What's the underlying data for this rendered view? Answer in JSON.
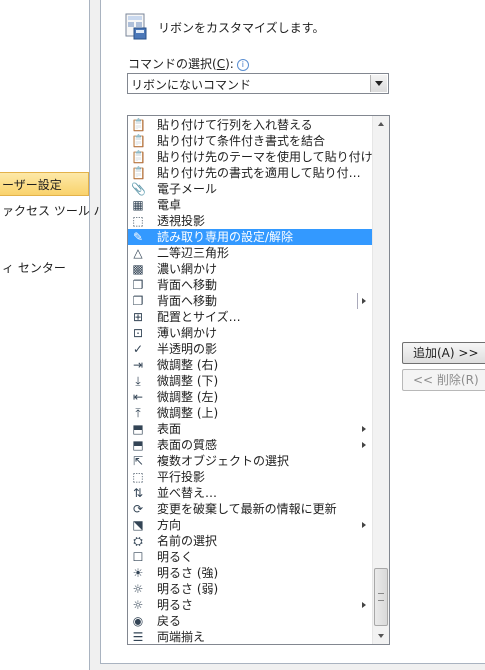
{
  "nav": {
    "items": [
      {
        "label": "ーザー設定",
        "selected": true
      },
      {
        "label": "ァクセス ツール バー",
        "selected": false
      },
      {
        "label": "ィ センター",
        "selected": false
      }
    ]
  },
  "header": {
    "title": "リボンをカスタマイズします。"
  },
  "commands": {
    "label": "コマンドの選択(C):",
    "label_prefix": "コマンドの選択(",
    "label_hotkey": "C",
    "label_suffix": "):",
    "info_icon": "i",
    "dropdown_value": "リボンにないコマンド"
  },
  "list": {
    "items": [
      {
        "label": "貼り付けて行列を入れ替える",
        "icon": "📋"
      },
      {
        "label": "貼り付けて条件付き書式を結合",
        "icon": "📋"
      },
      {
        "label": "貼り付け先のテーマを使用して貼り付け",
        "icon": "📋"
      },
      {
        "label": "貼り付け先の書式を適用して貼り付…",
        "icon": "📋"
      },
      {
        "label": "電子メール",
        "icon": "📎"
      },
      {
        "label": "電卓",
        "icon": "▦"
      },
      {
        "label": "透視投影",
        "icon": "⬚"
      },
      {
        "label": "読み取り専用の設定/解除",
        "icon": "✎",
        "selected": true
      },
      {
        "label": "二等辺三角形",
        "icon": "△"
      },
      {
        "label": "濃い網かけ",
        "icon": "▩"
      },
      {
        "label": "背面へ移動",
        "icon": "❐"
      },
      {
        "label": "背面へ移動",
        "icon": "❐",
        "split": true
      },
      {
        "label": "配置とサイズ…",
        "icon": "⊞"
      },
      {
        "label": "薄い網かけ",
        "icon": "⊡"
      },
      {
        "label": "半透明の影",
        "icon": "✓"
      },
      {
        "label": "微調整 (右)",
        "icon": "⇥"
      },
      {
        "label": "微調整 (下)",
        "icon": "⤓"
      },
      {
        "label": "微調整 (左)",
        "icon": "⇤"
      },
      {
        "label": "微調整 (上)",
        "icon": "⤒"
      },
      {
        "label": "表面",
        "icon": "⬒",
        "submenu": true
      },
      {
        "label": "表面の質感",
        "icon": "⬒",
        "submenu": true
      },
      {
        "label": "複数オブジェクトの選択",
        "icon": "⇱"
      },
      {
        "label": "平行投影",
        "icon": "⬚"
      },
      {
        "label": "並べ替え…",
        "icon": "⇅"
      },
      {
        "label": "変更を破棄して最新の情報に更新",
        "icon": "⟳"
      },
      {
        "label": "方向",
        "icon": "⬔",
        "submenu": true
      },
      {
        "label": "名前の選択",
        "icon": "⛭"
      },
      {
        "label": "明るく",
        "icon": "☐"
      },
      {
        "label": "明るさ (強)",
        "icon": "☀"
      },
      {
        "label": "明るさ (弱)",
        "icon": "☼"
      },
      {
        "label": "明るさ",
        "icon": "☼",
        "submenu": true
      },
      {
        "label": "戻る",
        "icon": "◉"
      },
      {
        "label": "両端揃え",
        "icon": "☰"
      }
    ]
  },
  "buttons": {
    "add": "追加(A) >>",
    "remove": "<< 削除(R)"
  },
  "colors": {
    "selection": "#3399ff",
    "nav_selected": "#f9d26c"
  }
}
